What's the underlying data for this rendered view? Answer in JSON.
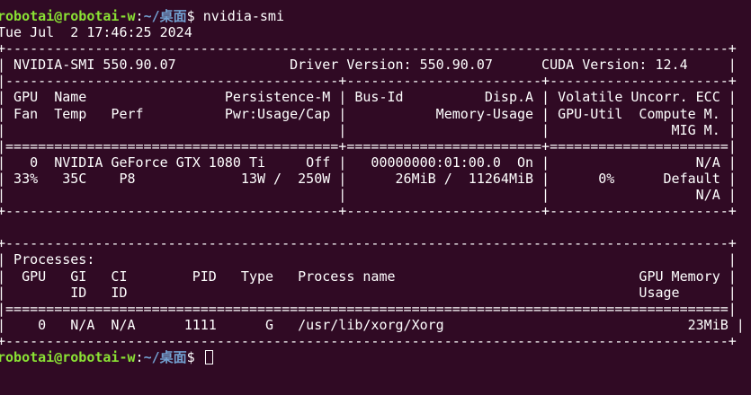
{
  "colors": {
    "background": "#300a24",
    "foreground": "#ffffff",
    "prompt_user": "#8ae234",
    "prompt_path": "#729fcf"
  },
  "prompt": {
    "user_host": "robotai@robotai-w",
    "separator": ":",
    "path": "~/桌面",
    "symbol": "$ "
  },
  "command": "nvidia-smi",
  "output_lines": [
    "Tue Jul  2 17:46:25 2024",
    "+-----------------------------------------------------------------------------------------+",
    "| NVIDIA-SMI 550.90.07              Driver Version: 550.90.07      CUDA Version: 12.4     |",
    "|-----------------------------------------+------------------------+----------------------+",
    "| GPU  Name                 Persistence-M | Bus-Id          Disp.A | Volatile Uncorr. ECC |",
    "| Fan  Temp   Perf          Pwr:Usage/Cap |           Memory-Usage | GPU-Util  Compute M. |",
    "|                                         |                        |               MIG M. |",
    "|=========================================+========================+======================|",
    "|   0  NVIDIA GeForce GTX 1080 Ti     Off |   00000000:01:00.0  On |                  N/A |",
    "| 33%   35C    P8             13W /  250W |      26MiB /  11264MiB |      0%      Default |",
    "|                                         |                        |                  N/A |",
    "+-----------------------------------------+------------------------+----------------------+",
    "",
    "+-----------------------------------------------------------------------------------------+",
    "| Processes:                                                                              |",
    "|  GPU   GI   CI        PID   Type   Process name                              GPU Memory |",
    "|        ID   ID                                                               Usage      |",
    "|=========================================================================================|",
    "|    0   N/A  N/A      1111      G   /usr/lib/xorg/Xorg                              23MiB |",
    "+-----------------------------------------------------------------------------------------+"
  ]
}
